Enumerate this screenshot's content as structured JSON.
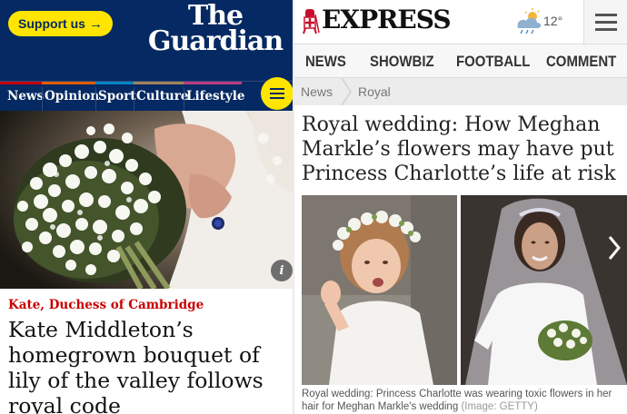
{
  "guardian": {
    "support_label": "Support us",
    "support_arrow": "→",
    "logo_line1": "The",
    "logo_line2": "Guardian",
    "nav": [
      {
        "label": "News",
        "color": "#c70000"
      },
      {
        "label": "Opinion",
        "color": "#e05e00"
      },
      {
        "label": "Sport",
        "color": "#0084c6"
      },
      {
        "label": "Culture",
        "color": "#a1845c"
      },
      {
        "label": "Lifestyle",
        "color": "#bb3b80"
      }
    ],
    "menu_icon": "hamburger-icon",
    "info_label": "i",
    "kicker": "Kate, Duchess of Cambridge",
    "headline": "Kate Middleton’s homegrown bouquet of lily of the valley follows royal code",
    "colors": {
      "brand": "#052962",
      "accent": "#ffe500",
      "kicker": "#c70000"
    }
  },
  "express": {
    "logo": "EXPRESS",
    "weather_icon": "cloud-sun-rain-icon",
    "temperature": "12°",
    "menu_icon": "hamburger-icon",
    "nav": [
      "NEWS",
      "SHOWBIZ",
      "FOOTBALL",
      "COMMENT"
    ],
    "breadcrumb": [
      "News",
      "Royal"
    ],
    "headline": "Royal wedding: How Meghan Markle’s flowers may have put Princess Charlotte’s life at risk",
    "caption": "Royal wedding: Princess Charlotte was wearing toxic flowers in her hair for Meghan Markle's wedding",
    "credit": "(Image: GETTY)",
    "next_icon": "chevron-right-icon",
    "colors": {
      "logo_red": "#c8102e"
    }
  }
}
